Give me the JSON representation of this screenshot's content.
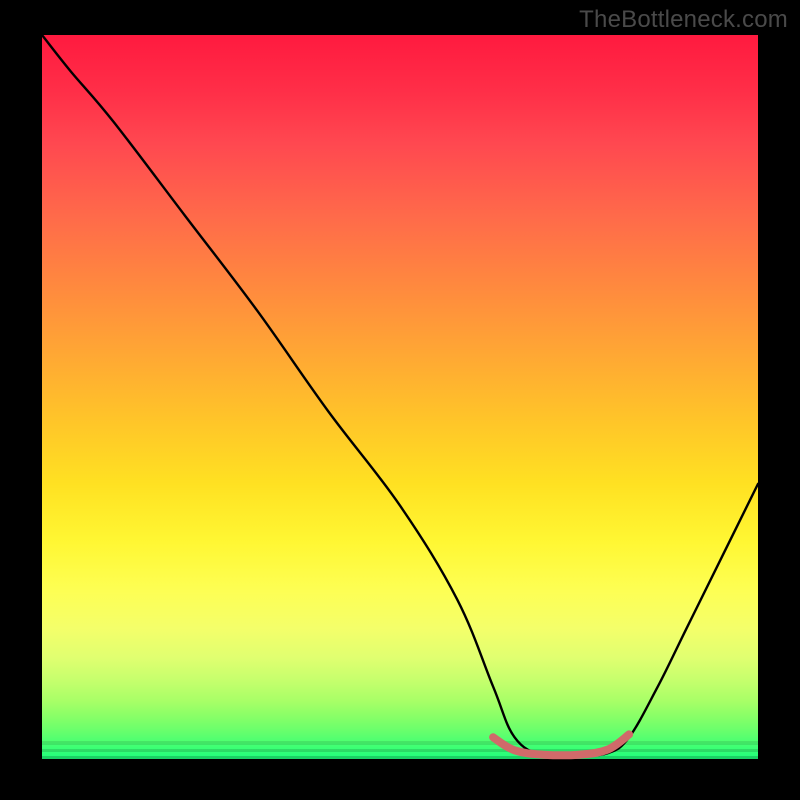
{
  "watermark": "TheBottleneck.com",
  "chart_data": {
    "type": "line",
    "title": "",
    "xlabel": "",
    "ylabel": "",
    "xlim": [
      0,
      100
    ],
    "ylim": [
      0,
      100
    ],
    "grid": false,
    "legend": false,
    "series": [
      {
        "name": "bottleneck-curve",
        "color": "#000000",
        "x": [
          0,
          4,
          10,
          20,
          30,
          40,
          50,
          58,
          63,
          66,
          70,
          75,
          79,
          82,
          86,
          90,
          95,
          100
        ],
        "y": [
          100,
          95,
          88,
          75,
          62,
          48,
          35,
          22,
          10,
          3,
          0.5,
          0.5,
          0.8,
          3,
          10,
          18,
          28,
          38
        ]
      }
    ],
    "highlight": {
      "name": "optimal-range",
      "color": "#d06a6a",
      "x": [
        63,
        66,
        70,
        75,
        79,
        82
      ],
      "y": [
        3,
        1.2,
        0.6,
        0.6,
        1.3,
        3.4
      ]
    },
    "palette": {
      "green": "#1dff7c",
      "yellow": "#fff733",
      "orange": "#ff8a3e",
      "red": "#ff1a3f",
      "black": "#000000",
      "highlight": "#d06a6a"
    }
  }
}
